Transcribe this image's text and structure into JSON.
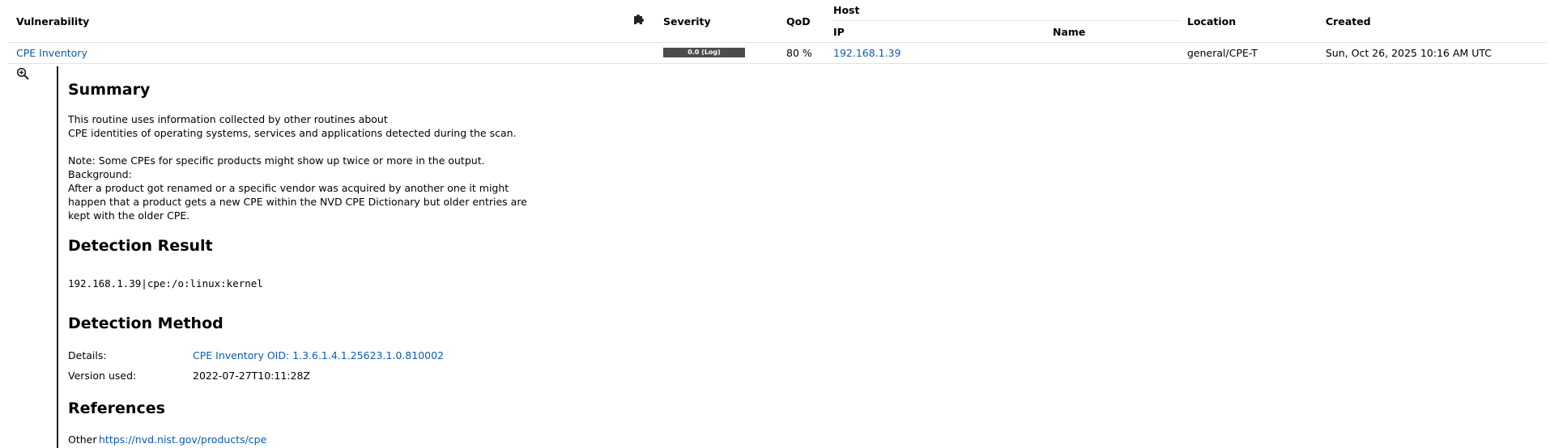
{
  "table": {
    "headers": {
      "vulnerability": "Vulnerability",
      "severity": "Severity",
      "qod": "QoD",
      "host": "Host",
      "ip": "IP",
      "name": "Name",
      "location": "Location",
      "created": "Created"
    },
    "row": {
      "vulnerability": "CPE Inventory",
      "severity_label": "0.0 (Log)",
      "qod": "80 %",
      "ip": "192.168.1.39",
      "name": "",
      "location": "general/CPE-T",
      "created": "Sun, Oct 26, 2025 10:16 AM UTC"
    }
  },
  "details": {
    "summary_heading": "Summary",
    "summary_line1": "This routine uses information collected by other routines about",
    "summary_line2": "CPE identities of operating systems, services and applications detected during the scan.",
    "note": "Note: Some CPEs for specific products might show up twice or more in the output. Background:",
    "background": "After a product got renamed or a specific vendor was acquired by another one it might happen that a product gets a new CPE within the NVD CPE Dictionary but older entries are kept with the older CPE.",
    "detection_result_heading": "Detection Result",
    "detection_result": "192.168.1.39|cpe:/o:linux:kernel",
    "detection_method_heading": "Detection Method",
    "details_label": "Details:",
    "details_link": "CPE Inventory OID: 1.3.6.1.4.1.25623.1.0.810002",
    "version_label": "Version used:",
    "version_value": "2022-07-27T10:11:28Z",
    "references_heading": "References",
    "other_label": "Other",
    "other_link": "https://nvd.nist.gov/products/cpe"
  },
  "icons": {
    "plugin": "puzzle-piece-icon",
    "zoom": "zoom-in-icon"
  },
  "colors": {
    "link": "#0b5cad",
    "severity_bar": "#4c4c4c"
  }
}
